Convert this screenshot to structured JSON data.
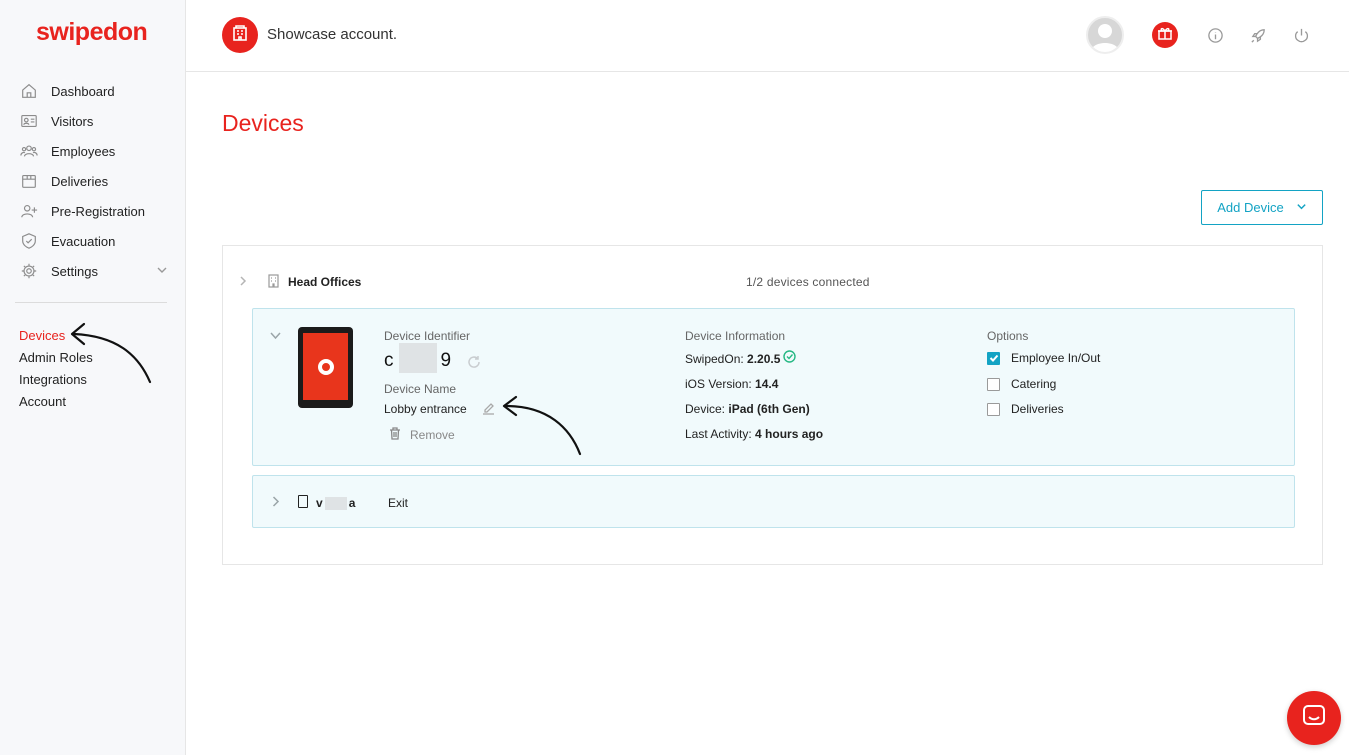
{
  "brand": {
    "logo_text": "swipedon",
    "accent_color": "#e8231e",
    "link_color": "#13a3c4"
  },
  "header": {
    "company_name": "Showcase account.",
    "icons": [
      "building-icon",
      "avatar",
      "gift-icon",
      "info-icon",
      "rocket-icon",
      "power-icon"
    ]
  },
  "sidebar": {
    "items": [
      {
        "label": "Dashboard",
        "icon": "home-icon"
      },
      {
        "label": "Visitors",
        "icon": "id-card-icon"
      },
      {
        "label": "Employees",
        "icon": "people-icon"
      },
      {
        "label": "Deliveries",
        "icon": "box-icon"
      },
      {
        "label": "Pre-Registration",
        "icon": "user-plus-icon"
      },
      {
        "label": "Evacuation",
        "icon": "shield-icon"
      },
      {
        "label": "Settings",
        "icon": "gear-icon"
      }
    ],
    "sub_items": [
      {
        "label": "Devices",
        "active": true
      },
      {
        "label": "Admin Roles"
      },
      {
        "label": "Integrations"
      },
      {
        "label": "Account"
      }
    ]
  },
  "main": {
    "title": "Devices",
    "add_device_label": "Add Device",
    "location": {
      "name": "Head Offices",
      "status": "1/2 devices connected"
    },
    "device1": {
      "identifier_label": "Device Identifier",
      "identifier_start": "c",
      "identifier_end": "9",
      "name_label": "Device Name",
      "name_value": "Lobby entrance",
      "remove_label": "Remove",
      "info_label": "Device Information",
      "info": [
        {
          "key": "SwipedOn:",
          "value": "2.20.5"
        },
        {
          "key": "iOS Version:",
          "value": "14.4"
        },
        {
          "key": "Device:",
          "value": "iPad (6th Gen)"
        },
        {
          "key": "Last Activity:",
          "value": "4 hours ago"
        }
      ],
      "options_label": "Options",
      "options": [
        {
          "label": "Employee In/Out",
          "checked": true
        },
        {
          "label": "Catering",
          "checked": false
        },
        {
          "label": "Deliveries",
          "checked": false
        }
      ]
    },
    "device2": {
      "name_start": "v",
      "name_end": "a",
      "status": "Exit"
    }
  }
}
